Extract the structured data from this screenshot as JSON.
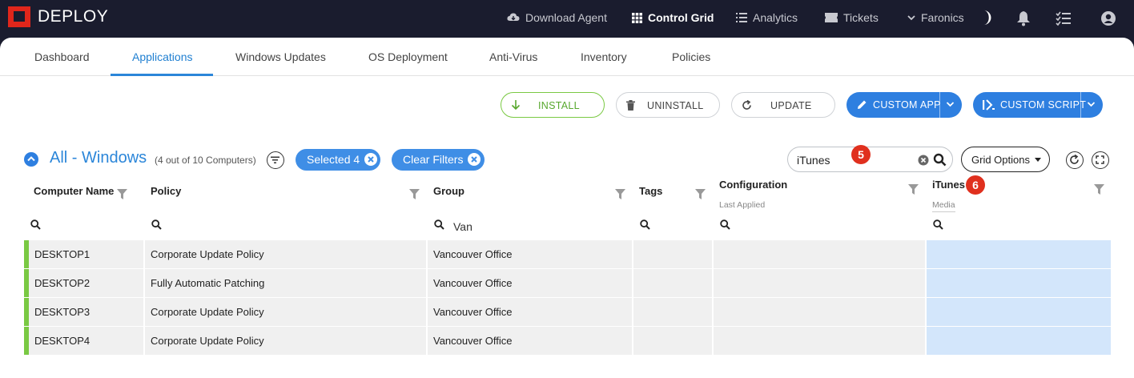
{
  "app": {
    "brand": "DEPLOY"
  },
  "topnav": [
    {
      "label": "Download Agent",
      "icon": "cloud-download-icon",
      "active": false
    },
    {
      "label": "Control Grid",
      "icon": "grid-icon",
      "active": true
    },
    {
      "label": "Analytics",
      "icon": "list-icon",
      "active": false
    },
    {
      "label": "Tickets",
      "icon": "ticket-icon",
      "active": false
    },
    {
      "label": "Faronics",
      "icon": "chevron-down-icon",
      "active": false
    }
  ],
  "tabs": [
    "Dashboard",
    "Applications",
    "Windows Updates",
    "OS Deployment",
    "Anti-Virus",
    "Inventory",
    "Policies"
  ],
  "active_tab": "Applications",
  "actions": {
    "install": "INSTALL",
    "uninstall": "UNINSTALL",
    "update": "UPDATE",
    "custom_app": "CUSTOM APP",
    "custom_script": "CUSTOM SCRIPT"
  },
  "grid": {
    "title": "All - Windows",
    "count": "(4 out of 10 Computers)",
    "selected_pill": "Selected 4",
    "clear_pill": "Clear Filters",
    "search_value": "iTunes",
    "grid_options": "Grid Options",
    "annotations": {
      "search": "5",
      "column": "6"
    }
  },
  "columns": [
    {
      "label": "Computer Name",
      "sub": "",
      "filter": ""
    },
    {
      "label": "Policy",
      "sub": "",
      "filter": ""
    },
    {
      "label": "Group",
      "sub": "",
      "filter": "Van"
    },
    {
      "label": "Tags",
      "sub": "",
      "filter": ""
    },
    {
      "label": "Configuration",
      "sub": "Last Applied",
      "filter": ""
    },
    {
      "label": "iTunes",
      "sub": "Media",
      "filter": ""
    }
  ],
  "rows": [
    {
      "computer": "DESKTOP1",
      "policy": "Corporate Update Policy",
      "group": "Vancouver Office",
      "tags": "",
      "config": "",
      "itunes": ""
    },
    {
      "computer": "DESKTOP2",
      "policy": "Fully Automatic Patching",
      "group": "Vancouver Office",
      "tags": "",
      "config": "",
      "itunes": ""
    },
    {
      "computer": "DESKTOP3",
      "policy": "Corporate Update Policy",
      "group": "Vancouver Office",
      "tags": "",
      "config": "",
      "itunes": ""
    },
    {
      "computer": "DESKTOP4",
      "policy": "Corporate Update Policy",
      "group": "Vancouver Office",
      "tags": "",
      "config": "",
      "itunes": ""
    }
  ],
  "colors": {
    "accent": "#2e7fe0",
    "brand": "#e0261b",
    "status_ok": "#7ac943",
    "highlight": "#d3e6fb",
    "badge": "#e0301e"
  }
}
